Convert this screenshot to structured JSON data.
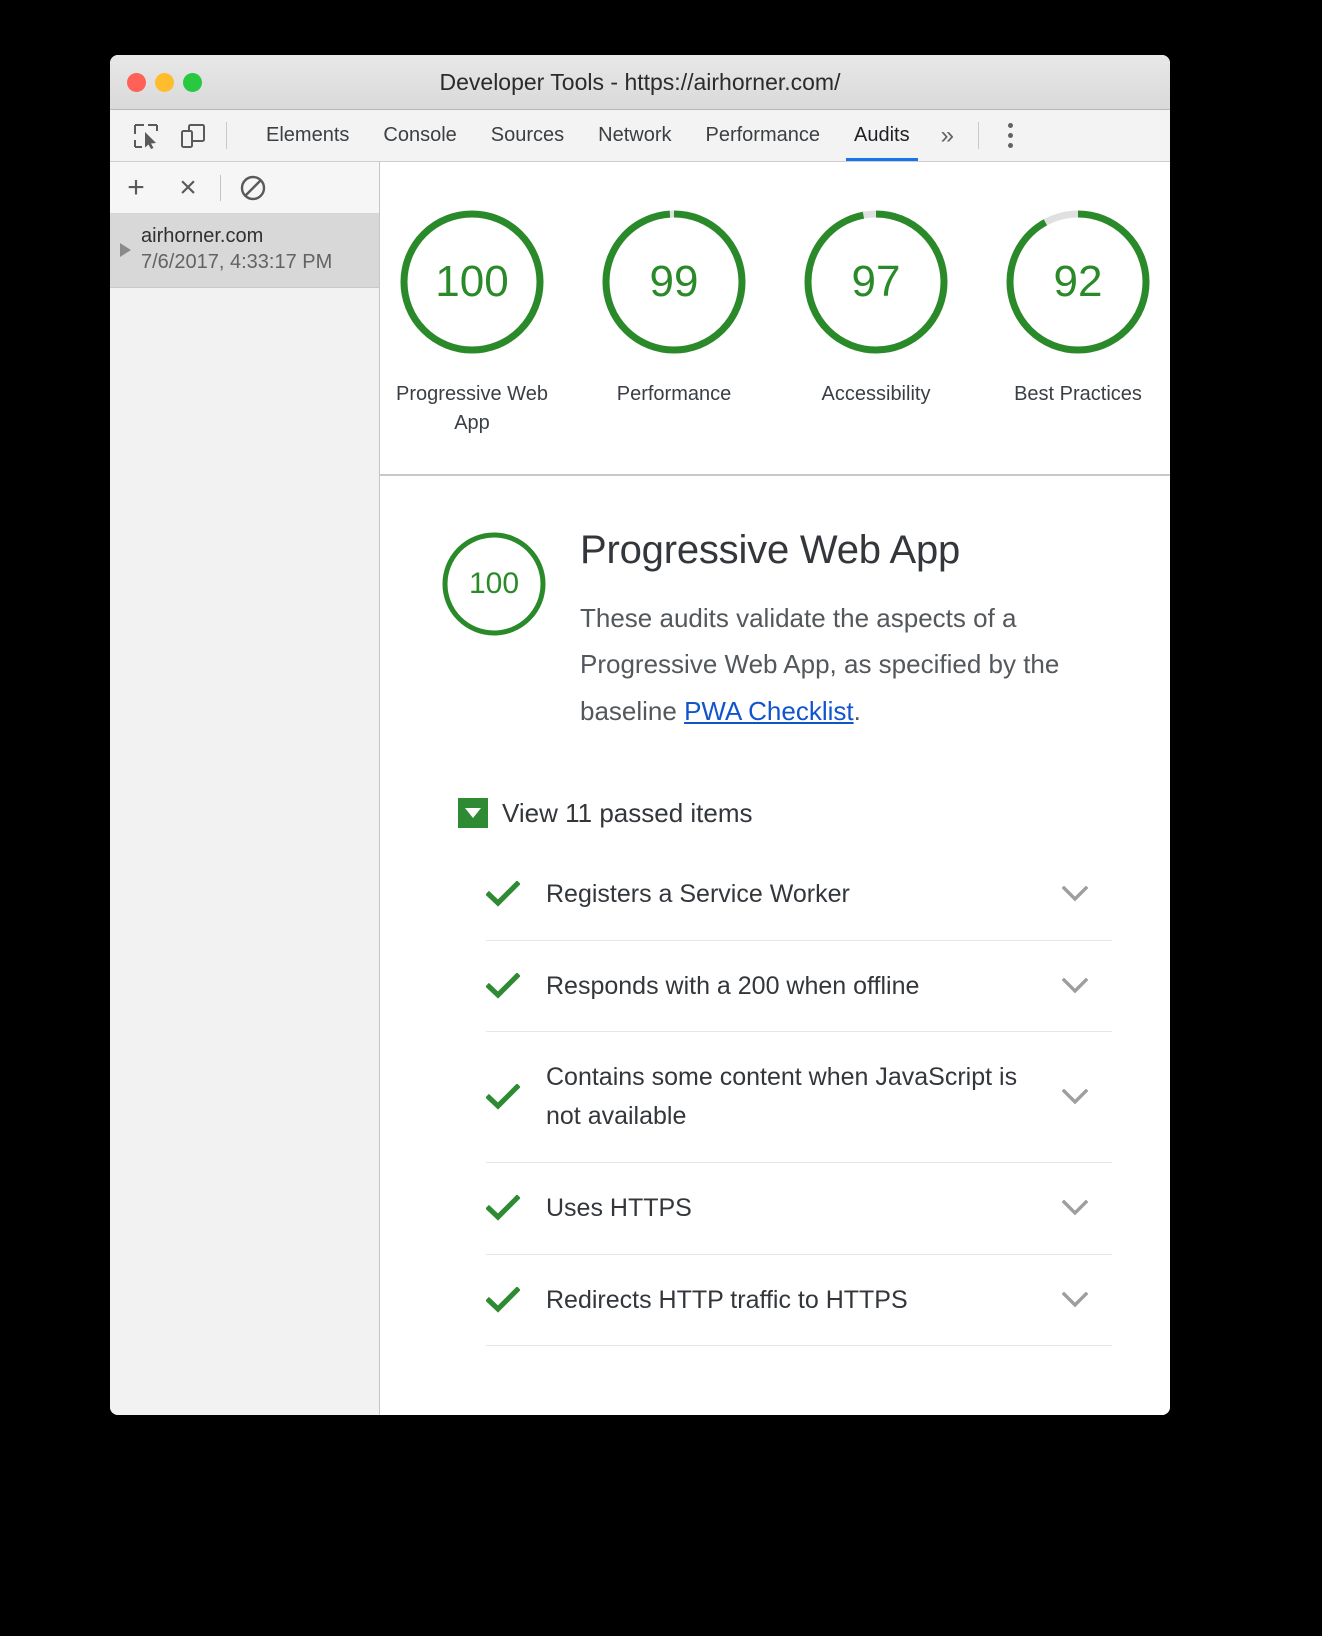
{
  "window": {
    "title": "Developer Tools - https://airhorner.com/",
    "traffic_lights": [
      "close",
      "minimize",
      "zoom"
    ],
    "colors": {
      "close": "#ff6057",
      "minimize": "#ffbd2e",
      "zoom": "#28c840"
    }
  },
  "toolbar": {
    "inspect_icon": "inspect-element-icon",
    "device_icon": "device-toolbar-icon",
    "overflow_label": "»",
    "menu_icon": "kebab-menu-icon",
    "tabs": [
      {
        "label": "Elements",
        "active": false
      },
      {
        "label": "Console",
        "active": false
      },
      {
        "label": "Sources",
        "active": false
      },
      {
        "label": "Network",
        "active": false
      },
      {
        "label": "Performance",
        "active": false
      },
      {
        "label": "Audits",
        "active": true
      }
    ],
    "active_tab_underline_color": "#1a73e8"
  },
  "sidebar": {
    "buttons": [
      {
        "name": "add-audit-button",
        "glyph": "+"
      },
      {
        "name": "clear-audit-button",
        "glyph": "×"
      },
      {
        "name": "block-requests-button",
        "glyph": "no-entry-icon"
      }
    ],
    "entry": {
      "host": "airhorner.com",
      "timestamp": "7/6/2017, 4:33:17 PM",
      "expander": "triangle-right-icon",
      "selected": true
    }
  },
  "scores": {
    "accent_color": "#2a8a2a",
    "track_color": "#e0e0e0",
    "items": [
      {
        "value": "100",
        "score": 100,
        "label": "Progressive Web App"
      },
      {
        "value": "99",
        "score": 99,
        "label": "Performance"
      },
      {
        "value": "97",
        "score": 97,
        "label": "Accessibility"
      },
      {
        "value": "92",
        "score": 92,
        "label": "Best Practices"
      }
    ]
  },
  "section": {
    "score": "100",
    "score_value": 100,
    "title": "Progressive Web App",
    "description_before": "These audits validate the aspects of a Progressive Web App, as specified by the baseline ",
    "link_text": "PWA Checklist",
    "description_after": ".",
    "link_color": "#1155cc"
  },
  "passed": {
    "toggle_label": "View 11 passed items",
    "expanded": true,
    "toggle_icon": "triangle-down-icon",
    "badge_color": "#2f8b33",
    "items": [
      {
        "title": "Registers a Service Worker",
        "status": "pass",
        "expander": "chevron-down-icon"
      },
      {
        "title": "Responds with a 200 when offline",
        "status": "pass",
        "expander": "chevron-down-icon"
      },
      {
        "title": "Contains some content when JavaScript is not available",
        "status": "pass",
        "expander": "chevron-down-icon"
      },
      {
        "title": "Uses HTTPS",
        "status": "pass",
        "expander": "chevron-down-icon"
      },
      {
        "title": "Redirects HTTP traffic to HTTPS",
        "status": "pass",
        "expander": "chevron-down-icon"
      }
    ]
  }
}
